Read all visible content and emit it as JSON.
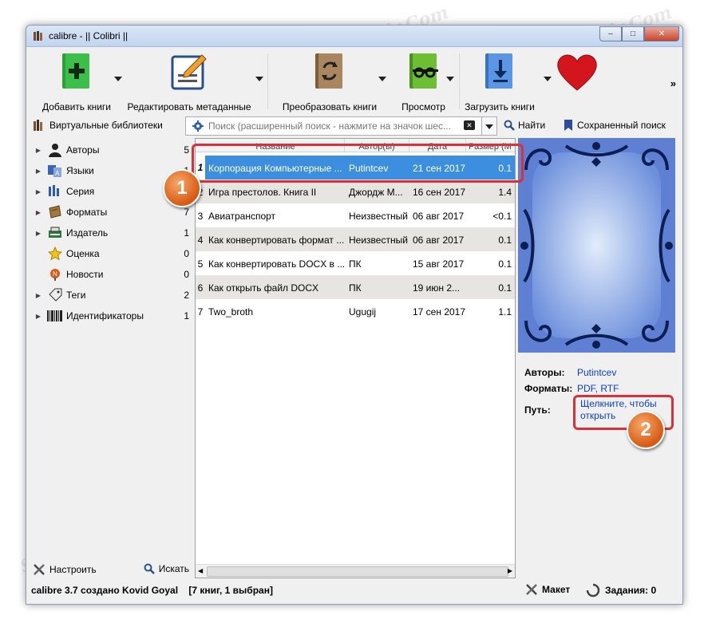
{
  "window": {
    "title": "calibre - || Colibri ||",
    "controls": {
      "minimize": "–",
      "maximize": "□",
      "close": "✕"
    }
  },
  "toolbar": {
    "add_books": "Добавить книги",
    "edit_metadata": "Редактировать метаданные",
    "convert_books": "Преобразовать книги",
    "view": "Просмотр",
    "get_books": "Загрузить книги",
    "more": "»"
  },
  "searchbar": {
    "virtual_libraries": "Виртуальные библиотеки",
    "search_placeholder": "Поиск (расширенный поиск - нажмите на значок шес...",
    "find": "Найти",
    "saved_search": "Сохраненный поиск"
  },
  "tag_browser": {
    "items": [
      {
        "label": "Авторы",
        "count": "5",
        "expandable": true,
        "icon": "person-icon"
      },
      {
        "label": "Языки",
        "count": "1",
        "expandable": true,
        "icon": "languages-icon"
      },
      {
        "label": "Серия",
        "count": "",
        "expandable": true,
        "icon": "series-icon"
      },
      {
        "label": "Форматы",
        "count": "7",
        "expandable": true,
        "icon": "book-icon"
      },
      {
        "label": "Издатель",
        "count": "1",
        "expandable": true,
        "icon": "publisher-icon"
      },
      {
        "label": "Оценка",
        "count": "0",
        "expandable": false,
        "icon": "star-icon"
      },
      {
        "label": "Новости",
        "count": "0",
        "expandable": false,
        "icon": "news-icon"
      },
      {
        "label": "Теги",
        "count": "2",
        "expandable": true,
        "icon": "tag-icon"
      },
      {
        "label": "Идентификаторы",
        "count": "1",
        "expandable": true,
        "icon": "barcode-icon"
      }
    ],
    "configure": "Настроить",
    "find": "Искать"
  },
  "book_list": {
    "columns": [
      "Название",
      "Автор(ы)",
      "Дата",
      "Размер (М"
    ],
    "rows": [
      {
        "num": "1",
        "title": "Корпорация Компьютерные ...",
        "author": "Putintcev",
        "date": "21 сен 2017",
        "size": "0.1",
        "selected": true
      },
      {
        "num": "2",
        "title": "Игра престолов. Книга II",
        "author": "Джордж М...",
        "date": "16 сен 2017",
        "size": "1.4"
      },
      {
        "num": "3",
        "title": "Авиатранспорт",
        "author": "Неизвестный",
        "date": "06 авг 2017",
        "size": "<0.1"
      },
      {
        "num": "4",
        "title": "Как конвертировать формат ...",
        "author": "Неизвестный",
        "date": "06 авг 2017",
        "size": "0.1"
      },
      {
        "num": "5",
        "title": "Как конвертировать DOCX в ...",
        "author": "ПК",
        "date": "15 авг 2017",
        "size": "0.1"
      },
      {
        "num": "6",
        "title": "Как открыть файл DOCX",
        "author": "ПК",
        "date": "19 июн 2...",
        "size": "0.1"
      },
      {
        "num": "7",
        "title": "Two_broth",
        "author": "Ugugij",
        "date": "17 сен 2017",
        "size": "1.1"
      }
    ]
  },
  "details": {
    "authors_label": "Авторы:",
    "authors_value": "Putintcev",
    "formats_label": "Форматы:",
    "formats_value": "PDF, RTF",
    "path_label": "Путь:",
    "path_value_line1": "Щелкните, чтобы",
    "path_value_line2": "открыть"
  },
  "status": {
    "text": "calibre 3.7 создано Kovid Goyal",
    "count": "[7 книг, 1 выбран]",
    "layout": "Макет",
    "jobs": "Задания: 0"
  },
  "annotations": {
    "badge1": "1",
    "badge2": "2"
  },
  "watermark": "Soringpcrepair.Com",
  "colors": {
    "selection": "#3b8fde",
    "callout": "#d9313b",
    "badge": "#e0691c",
    "link": "#0b3fd0"
  }
}
